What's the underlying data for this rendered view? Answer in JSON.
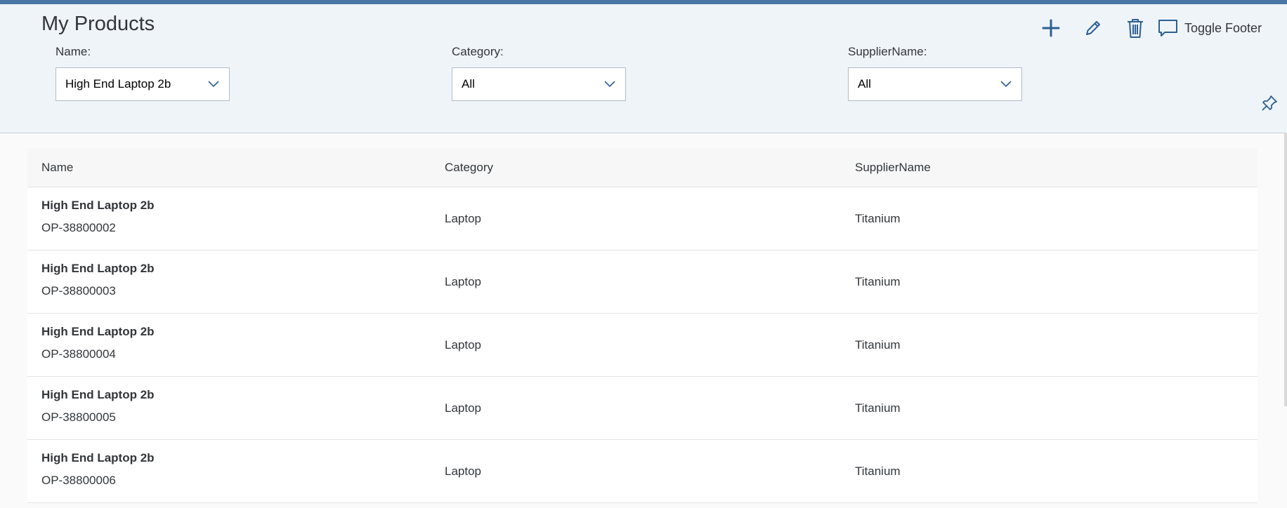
{
  "page": {
    "title": "My Products",
    "accent_color": "#4a76a3",
    "header_bg": "#eff4f9"
  },
  "toolbar": {
    "add_icon": "plus-icon",
    "edit_icon": "pencil-icon",
    "delete_icon": "trash-icon",
    "toggle_footer_icon": "message-icon",
    "toggle_footer_label": "Toggle Footer",
    "pin_icon": "pushpin-icon"
  },
  "filters": {
    "name": {
      "label": "Name:",
      "value": "High End Laptop 2b"
    },
    "category": {
      "label": "Category:",
      "value": "All"
    },
    "supplier": {
      "label": "SupplierName:",
      "value": "All"
    }
  },
  "table": {
    "columns": [
      "Name",
      "Category",
      "SupplierName"
    ],
    "rows": [
      {
        "name": "High End Laptop 2b",
        "id": "OP-38800002",
        "category": "Laptop",
        "supplier": "Titanium"
      },
      {
        "name": "High End Laptop 2b",
        "id": "OP-38800003",
        "category": "Laptop",
        "supplier": "Titanium"
      },
      {
        "name": "High End Laptop 2b",
        "id": "OP-38800004",
        "category": "Laptop",
        "supplier": "Titanium"
      },
      {
        "name": "High End Laptop 2b",
        "id": "OP-38800005",
        "category": "Laptop",
        "supplier": "Titanium"
      },
      {
        "name": "High End Laptop 2b",
        "id": "OP-38800006",
        "category": "Laptop",
        "supplier": "Titanium"
      }
    ]
  }
}
